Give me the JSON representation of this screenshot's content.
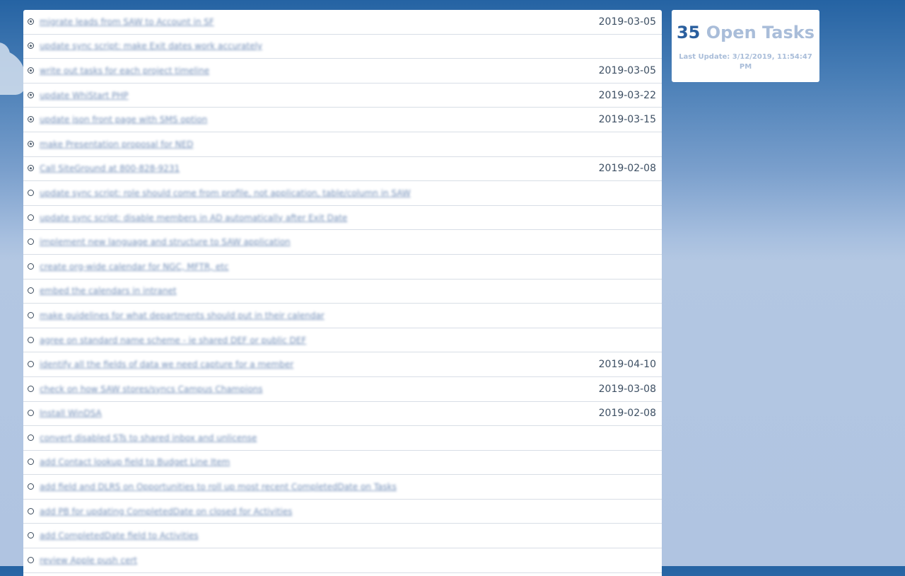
{
  "colors": {
    "background_top": "#2563a3",
    "background_bottom": "#b0c4e1",
    "link": "#4f72a6",
    "date": "#3d4f63",
    "count": "#2a5f9e",
    "muted": "#a9bdd9"
  },
  "summary": {
    "count": "35",
    "label": "Open Tasks",
    "last_update": "Last Update: 3/12/2019, 11:54:47 PM"
  },
  "tasks": [
    {
      "title": "migrate leads from SAW to Account in SF",
      "date": "2019-03-05",
      "starred": true
    },
    {
      "title": "update sync script: make Exit dates work accurately",
      "date": "",
      "starred": true
    },
    {
      "title": "write out tasks for each project timeline",
      "date": "2019-03-05",
      "starred": true
    },
    {
      "title": "update WhiStart PHP",
      "date": "2019-03-22",
      "starred": true
    },
    {
      "title": "update json front page with SMS option",
      "date": "2019-03-15",
      "starred": true
    },
    {
      "title": "make Presentation proposal for NED",
      "date": "",
      "starred": true
    },
    {
      "title": "Call SiteGround at 800-828-9231",
      "date": "2019-02-08",
      "starred": true
    },
    {
      "title": "update sync script: role should come from profile, not application, table/column in SAW",
      "date": "",
      "starred": false
    },
    {
      "title": "update sync script: disable members in AD automatically after Exit Date",
      "date": "",
      "starred": false
    },
    {
      "title": "implement new language and structure to SAW application",
      "date": "",
      "starred": false
    },
    {
      "title": "create org-wide calendar for NGC, MFTR, etc",
      "date": "",
      "starred": false
    },
    {
      "title": "embed the calendars in intranet",
      "date": "",
      "starred": false
    },
    {
      "title": "make guidelines for what departments should put in their calendar",
      "date": "",
      "starred": false
    },
    {
      "title": "agree on standard name scheme - ie shared DEF or public DEF",
      "date": "",
      "starred": false
    },
    {
      "title": "identify all the fields of data we need capture for a member",
      "date": "2019-04-10",
      "starred": false
    },
    {
      "title": "check on how SAW stores/syncs Campus Champions",
      "date": "2019-03-08",
      "starred": false
    },
    {
      "title": "Install WinDSA",
      "date": "2019-02-08",
      "starred": false
    },
    {
      "title": "convert disabled STs to shared inbox and unlicense",
      "date": "",
      "starred": false
    },
    {
      "title": "add Contact lookup field to Budget Line Item",
      "date": "",
      "starred": false
    },
    {
      "title": "add field and DLRS on Opportunities to roll up most recent CompletedDate on Tasks",
      "date": "",
      "starred": false
    },
    {
      "title": "add PB for updating CompletedDate on closed for Activities",
      "date": "",
      "starred": false
    },
    {
      "title": "add CompletedDate field to Activities",
      "date": "",
      "starred": false
    },
    {
      "title": "review Apple push cert",
      "date": "",
      "starred": false
    }
  ]
}
